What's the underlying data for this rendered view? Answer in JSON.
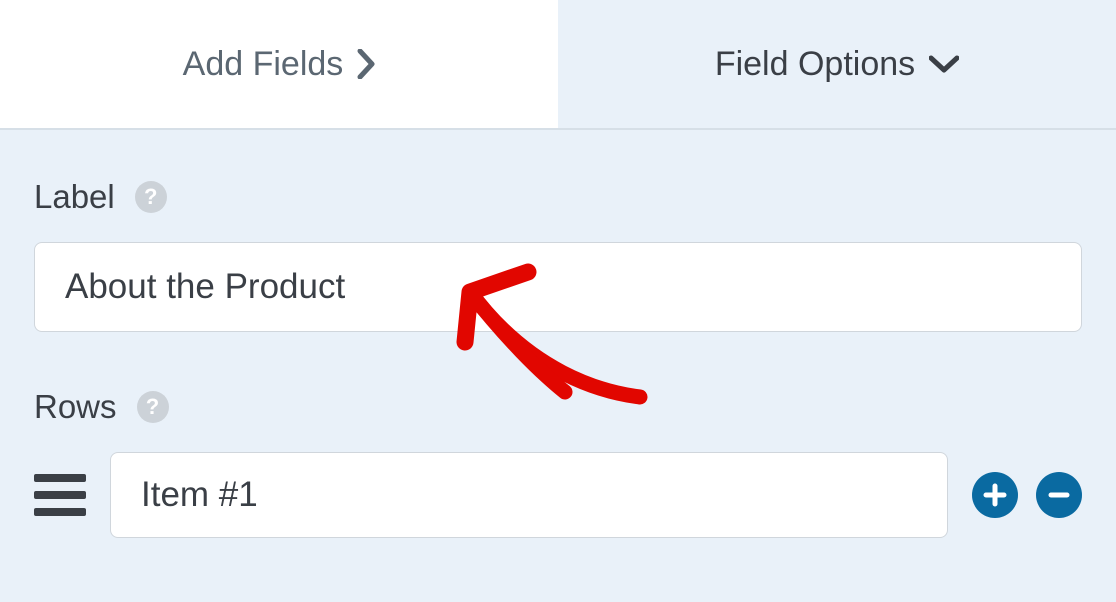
{
  "tabs": {
    "add_fields": "Add Fields",
    "field_options": "Field Options"
  },
  "sections": {
    "label": {
      "title": "Label",
      "value": "About the Product"
    },
    "rows": {
      "title": "Rows",
      "items": [
        {
          "value": "Item #1"
        }
      ]
    }
  },
  "colors": {
    "accent": "#0a6aa1",
    "annotation": "#e10600"
  }
}
